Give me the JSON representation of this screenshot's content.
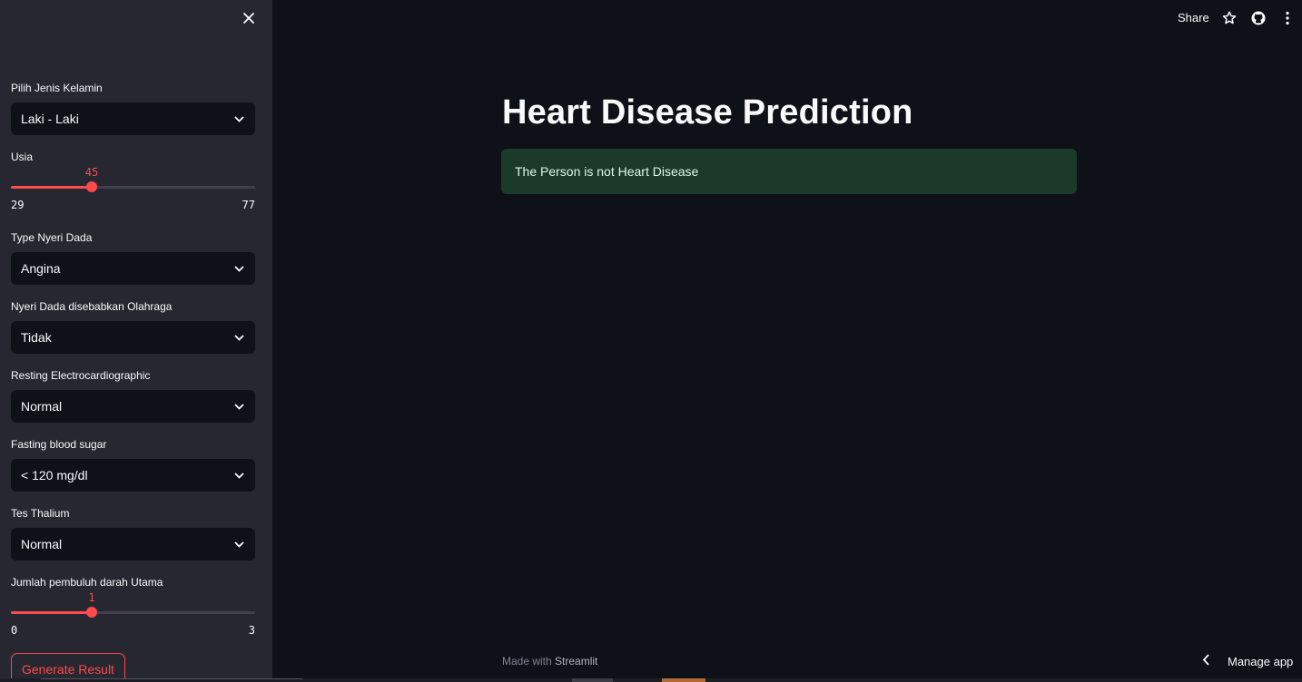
{
  "sidebar": {
    "fields": [
      {
        "label": "Pilih Jenis Kelamin",
        "value": "Laki - Laki"
      },
      {
        "label": "Type Nyeri Dada",
        "value": "Angina"
      },
      {
        "label": "Nyeri Dada disebabkan Olahraga",
        "value": "Tidak"
      },
      {
        "label": "Resting Electrocardiographic",
        "value": "Normal"
      },
      {
        "label": "Fasting blood sugar",
        "value": "< 120 mg/dl"
      },
      {
        "label": "Tes Thalium",
        "value": "Normal"
      }
    ],
    "sliders": {
      "usia": {
        "label": "Usia",
        "value": "45",
        "min": "29",
        "max": "77"
      },
      "pembuluh": {
        "label": "Jumlah pembuluh darah Utama",
        "value": "1",
        "min": "0",
        "max": "3"
      }
    },
    "generate_label": "Generate Result"
  },
  "header": {
    "share_label": "Share"
  },
  "main": {
    "title": "Heart Disease Prediction",
    "result": "The Person is not Heart Disease"
  },
  "footer": {
    "made_with": "Made with",
    "brand": "Streamlit",
    "manage": "Manage app"
  },
  "colors": {
    "accent": "#ff4b4b",
    "success_bg": "#1b3a2a",
    "sidebar_bg": "#262730",
    "main_bg": "#0e1117"
  },
  "icons": [
    "close-icon",
    "chevron-down-icon",
    "star-icon",
    "github-icon",
    "more-vertical-icon",
    "chevron-left-icon"
  ]
}
